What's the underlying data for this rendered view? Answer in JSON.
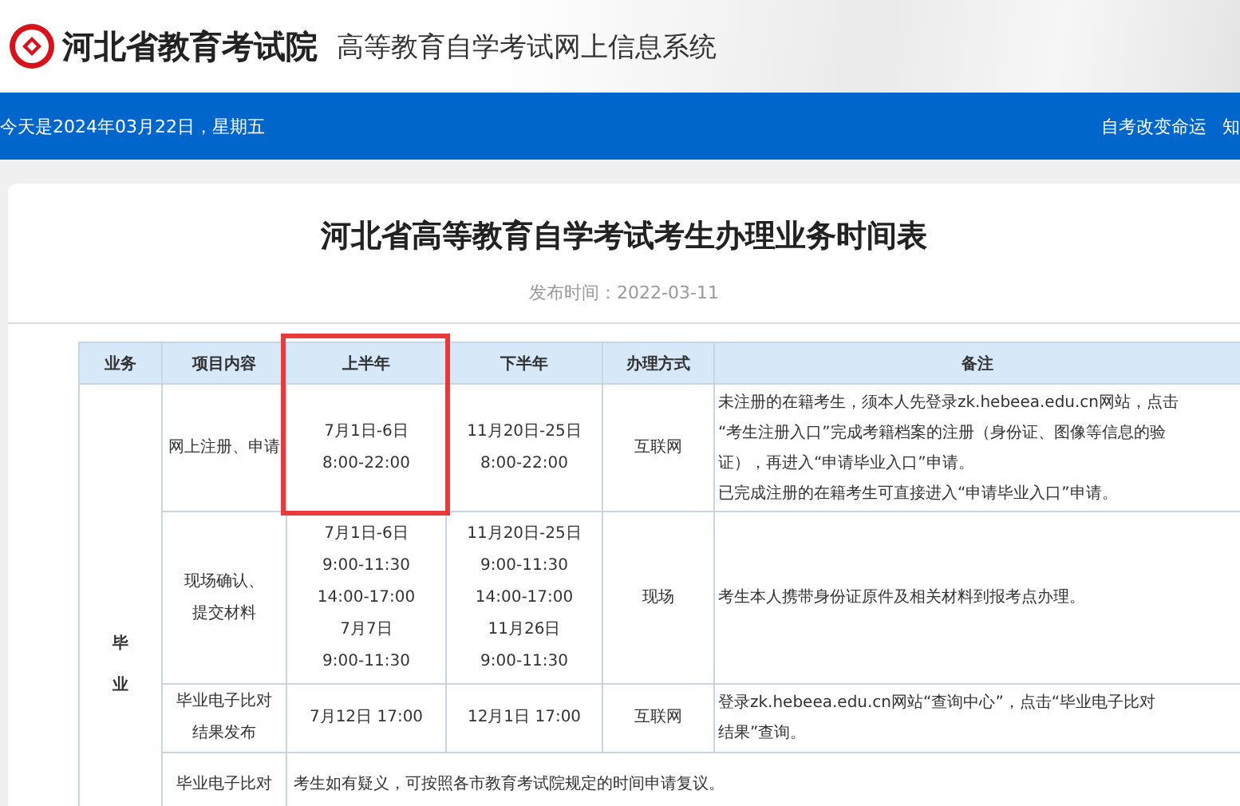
{
  "header": {
    "org_name": "河北省教育考试院",
    "system_name": "高等教育自学考试网上信息系统"
  },
  "nav_bar": {
    "date_text": "今天是2024年03月22日，星期五",
    "links": [
      "自考改变命运",
      "知"
    ]
  },
  "article": {
    "title": "河北省高等教育自学考试考生办理业务时间表",
    "publish_time": "发布时间：2022-03-11"
  },
  "table": {
    "columns": [
      {
        "label": "业务",
        "highlighted": false
      },
      {
        "label": "项目内容",
        "highlighted": false
      },
      {
        "label": "上半年",
        "highlighted": true
      },
      {
        "label": "下半年",
        "highlighted": false
      },
      {
        "label": "办理方式",
        "highlighted": false
      },
      {
        "label": "备注",
        "highlighted": false
      }
    ],
    "group_label": [
      "毕",
      "业"
    ],
    "rows": [
      {
        "kind": "standard",
        "item": [
          "网上注册、申请"
        ],
        "first_half": [
          "7月1日-6日",
          "8:00-22:00"
        ],
        "second_half": [
          "11月20日-25日",
          "8:00-22:00"
        ],
        "method": "互联网",
        "note": [
          "未注册的在籍考生，须本人先登录zk.hebeea.edu.cn网站，点击",
          "“考生注册入口”完成考籍档案的注册（身份证、图像等信息的验",
          "证），再进入“申请毕业入口”申请。",
          "已完成注册的在籍考生可直接进入“申请毕业入口”申请。"
        ]
      },
      {
        "kind": "standard",
        "item": [
          "现场确认、",
          "提交材料"
        ],
        "first_half": [
          "7月1日-6日",
          "9:00-11:30",
          "14:00-17:00",
          "7月7日",
          "9:00-11:30"
        ],
        "second_half": [
          "11月20日-25日",
          "9:00-11:30",
          "14:00-17:00",
          "11月26日",
          "9:00-11:30"
        ],
        "method": "现场",
        "note": [
          "考生本人携带身份证原件及相关材料到报考点办理。"
        ]
      },
      {
        "kind": "standard",
        "item": [
          "毕业电子比对",
          "结果发布"
        ],
        "first_half": [
          "7月12日 17:00"
        ],
        "second_half": [
          "12月1日 17:00"
        ],
        "method": "互联网",
        "note": [
          "登录zk.hebeea.edu.cn网站“查询中心”，点击“毕业电子比对",
          "结果”查询。"
        ]
      },
      {
        "kind": "merged",
        "item": [
          "毕业电子比对"
        ],
        "first_half": [
          "考生如有疑义，可按照各市教育考试院规定的时间申请复议。"
        ]
      }
    ]
  }
}
